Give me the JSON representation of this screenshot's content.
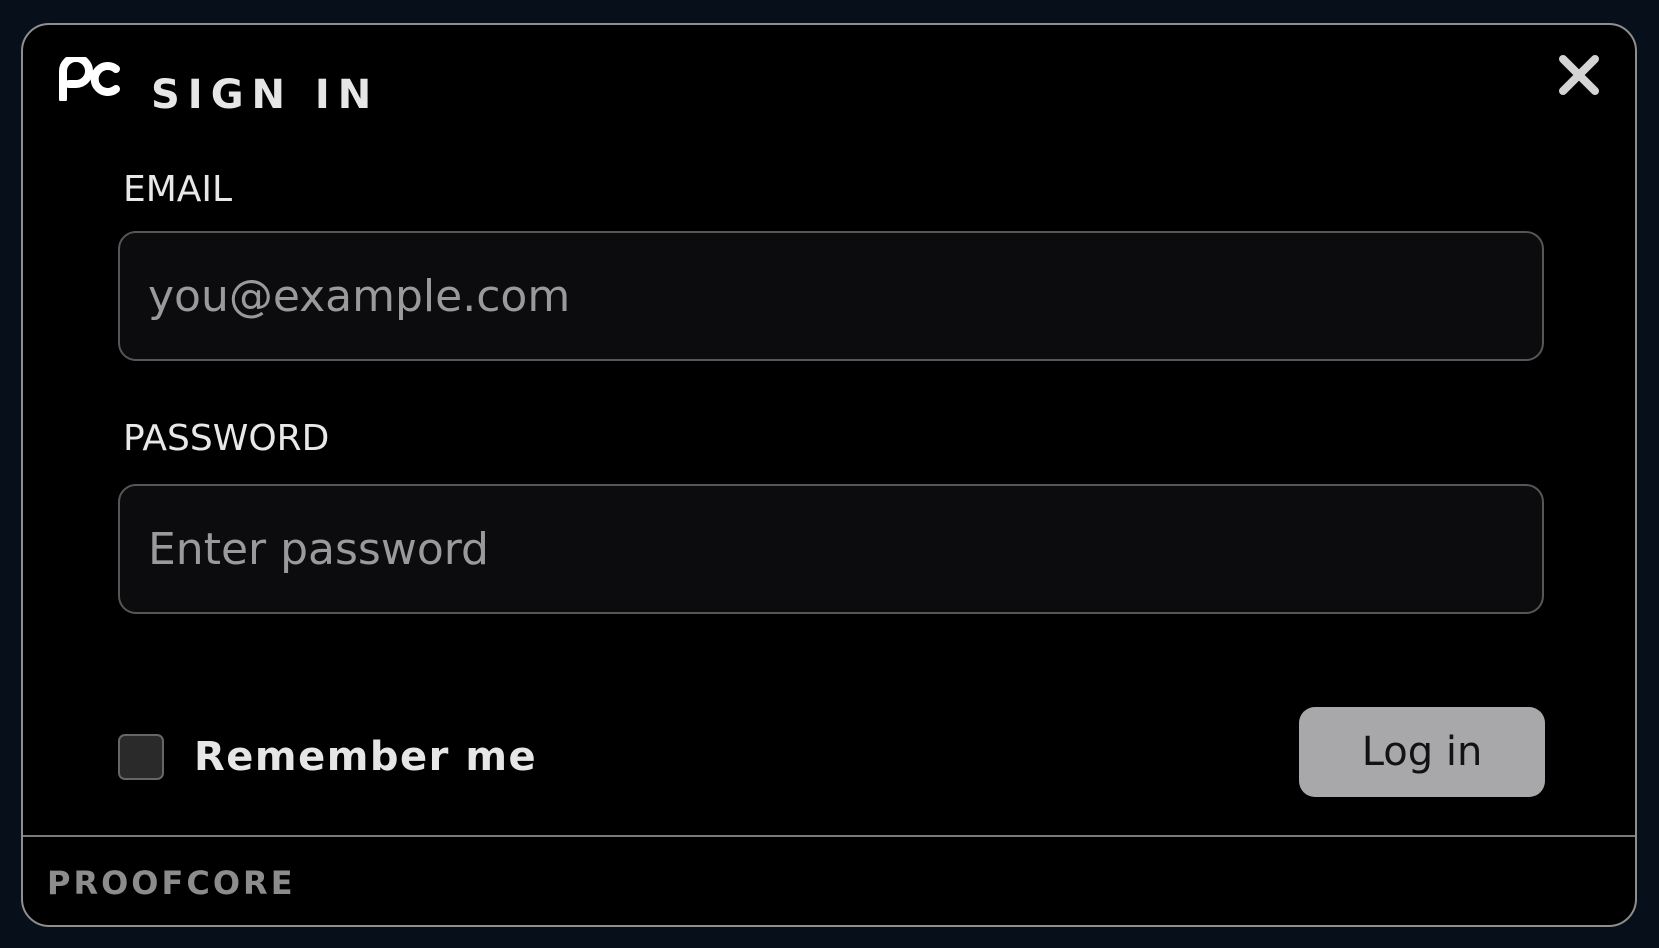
{
  "dialog": {
    "title": "SIGN IN",
    "logo": "proofcore-pc-logo",
    "close_icon": "close-icon"
  },
  "form": {
    "email": {
      "label": "EMAIL",
      "placeholder": "you@example.com",
      "value": ""
    },
    "password": {
      "label": "PASSWORD",
      "placeholder": "Enter password",
      "value": ""
    },
    "remember": {
      "label": "Remember me",
      "checked": false
    },
    "submit_label": "Log in"
  },
  "footer": {
    "brand": "PROOFCORE"
  },
  "colors": {
    "page_background": "#07101a",
    "dialog_background": "#000000",
    "button_background": "#a8a8aa",
    "text": "#e6e6e6",
    "muted": "#8c8c8c"
  }
}
